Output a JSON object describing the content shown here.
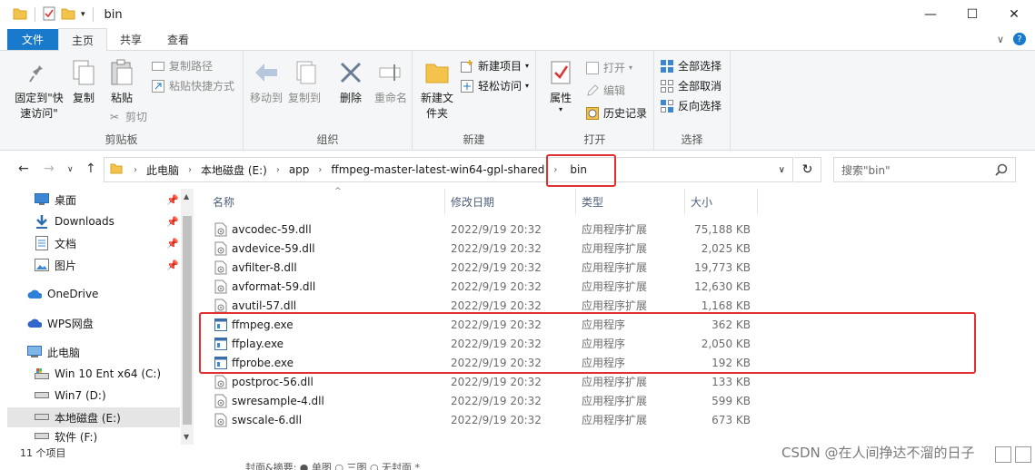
{
  "window": {
    "title": "bin",
    "minimize": "—",
    "maximize": "☐",
    "close": "✕"
  },
  "ribbon_tabs": [
    "文件",
    "主页",
    "共享",
    "查看"
  ],
  "ribbon": {
    "clipboard": {
      "label": "剪贴板",
      "pin_quick": "固定到\"快速访问\"",
      "copy": "复制",
      "paste": "粘贴",
      "copy_path": "复制路径",
      "paste_shortcut": "粘贴快捷方式",
      "cut": "剪切"
    },
    "organize": {
      "label": "组织",
      "move_to": "移动到",
      "copy_to": "复制到",
      "delete": "删除",
      "rename": "重命名"
    },
    "new": {
      "label": "新建",
      "new_folder": "新建文件夹",
      "new_item": "新建项目",
      "easy_access": "轻松访问"
    },
    "open": {
      "label": "打开",
      "properties": "属性",
      "open": "打开",
      "edit": "编辑",
      "history": "历史记录"
    },
    "select": {
      "label": "选择",
      "select_all": "全部选择",
      "select_none": "全部取消",
      "invert": "反向选择"
    }
  },
  "address": {
    "crumbs": [
      "此电脑",
      "本地磁盘 (E:)",
      "app",
      "ffmpeg-master-latest-win64-gpl-shared",
      "bin"
    ]
  },
  "search": {
    "placeholder": "搜索\"bin\""
  },
  "nav_pane": {
    "quick": [
      {
        "label": "桌面",
        "icon": "desktop-icon"
      },
      {
        "label": "Downloads",
        "icon": "download-icon"
      },
      {
        "label": "文档",
        "icon": "document-icon"
      },
      {
        "label": "图片",
        "icon": "picture-icon"
      }
    ],
    "onedrive": "OneDrive",
    "wps": "WPS网盘",
    "thispc": "此电脑",
    "drives": [
      "Win 10 Ent x64 (C:)",
      "Win7 (D:)",
      "本地磁盘 (E:)",
      "软件 (F:)"
    ]
  },
  "columns": {
    "name": "名称",
    "date": "修改日期",
    "type": "类型",
    "size": "大小"
  },
  "files": [
    {
      "name": "avcodec-59.dll",
      "date": "2022/9/19 20:32",
      "type": "应用程序扩展",
      "size": "75,188 KB",
      "kind": "dll"
    },
    {
      "name": "avdevice-59.dll",
      "date": "2022/9/19 20:32",
      "type": "应用程序扩展",
      "size": "2,025 KB",
      "kind": "dll"
    },
    {
      "name": "avfilter-8.dll",
      "date": "2022/9/19 20:32",
      "type": "应用程序扩展",
      "size": "19,773 KB",
      "kind": "dll"
    },
    {
      "name": "avformat-59.dll",
      "date": "2022/9/19 20:32",
      "type": "应用程序扩展",
      "size": "12,630 KB",
      "kind": "dll"
    },
    {
      "name": "avutil-57.dll",
      "date": "2022/9/19 20:32",
      "type": "应用程序扩展",
      "size": "1,168 KB",
      "kind": "dll"
    },
    {
      "name": "ffmpeg.exe",
      "date": "2022/9/19 20:32",
      "type": "应用程序",
      "size": "362 KB",
      "kind": "exe"
    },
    {
      "name": "ffplay.exe",
      "date": "2022/9/19 20:32",
      "type": "应用程序",
      "size": "2,050 KB",
      "kind": "exe"
    },
    {
      "name": "ffprobe.exe",
      "date": "2022/9/19 20:32",
      "type": "应用程序",
      "size": "192 KB",
      "kind": "exe"
    },
    {
      "name": "postproc-56.dll",
      "date": "2022/9/19 20:32",
      "type": "应用程序扩展",
      "size": "133 KB",
      "kind": "dll"
    },
    {
      "name": "swresample-4.dll",
      "date": "2022/9/19 20:32",
      "type": "应用程序扩展",
      "size": "599 KB",
      "kind": "dll"
    },
    {
      "name": "swscale-6.dll",
      "date": "2022/9/19 20:32",
      "type": "应用程序扩展",
      "size": "673 KB",
      "kind": "dll"
    }
  ],
  "status": {
    "count": "11 个项目"
  },
  "overlap_text": "封面&摘要: ● 单图  ○ 三图  ○ 无封面 *",
  "watermark": "CSDN @在人间挣达不溜的日子",
  "colors": {
    "accent": "#1979ca",
    "highlight": "#e23030"
  }
}
